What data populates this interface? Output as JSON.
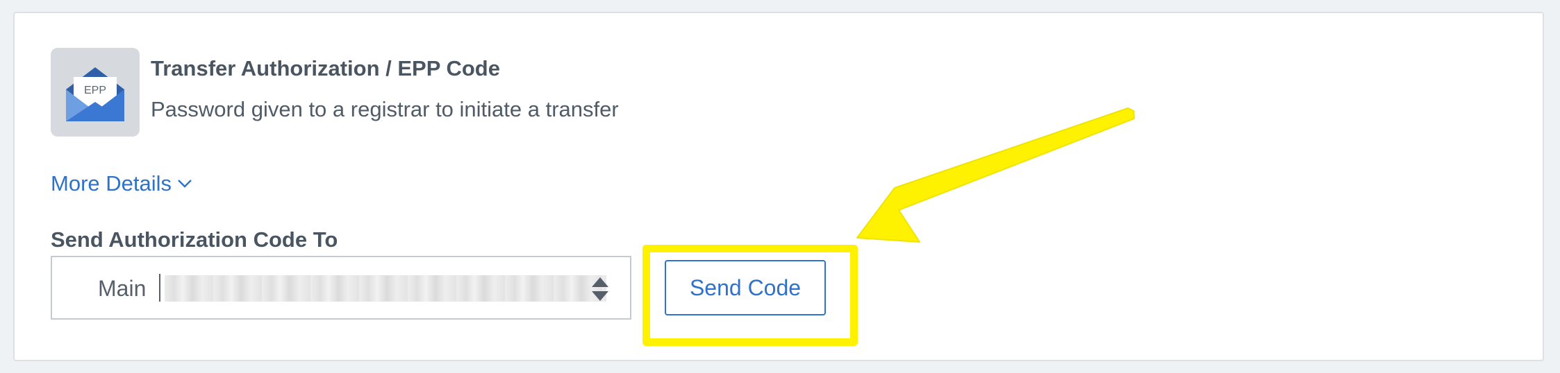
{
  "card": {
    "title": "Transfer Authorization / EPP Code",
    "subtitle": "Password given to a registrar to initiate a transfer",
    "icon_label": "EPP",
    "icon_name": "envelope-epp-icon",
    "more_details_label": "More Details",
    "field_label": "Send Authorization Code To",
    "select_value": "Main",
    "send_button_label": "Send Code"
  },
  "colors": {
    "accent": "#2f72c9",
    "highlight": "#fff200",
    "text_primary": "#4a5562",
    "icon_tile": "#d6dade"
  }
}
